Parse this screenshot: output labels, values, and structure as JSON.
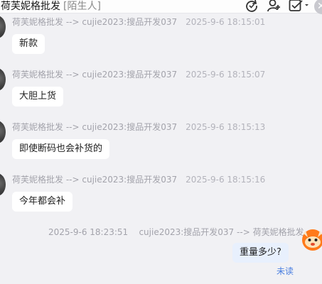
{
  "header": {
    "contact_name": "荷芙妮格批发",
    "stranger_tag": "[陌生人]",
    "icons": [
      "refresh-icon",
      "add-user-icon",
      "check-square-icon",
      "close-icon"
    ]
  },
  "messages": [
    {
      "sender": "荷芙妮格批发",
      "arrow": "-->",
      "receiver": "cujie2023:搜品开发037",
      "time": "2025-9-6 18:15:01",
      "text": "新款"
    },
    {
      "sender": "荷芙妮格批发",
      "arrow": "-->",
      "receiver": "cujie2023:搜品开发037",
      "time": "2025-9-6 18:15:07",
      "text": "大胆上货"
    },
    {
      "sender": "荷芙妮格批发",
      "arrow": "-->",
      "receiver": "cujie2023:搜品开发037",
      "time": "2025-9-6 18:15:13",
      "text": "即使断码也会补货的"
    },
    {
      "sender": "荷芙妮格批发",
      "arrow": "-->",
      "receiver": "cujie2023:搜品开发037",
      "time": "2025-9-6 18:15:16",
      "text": "今年都会补"
    },
    {
      "sender": "cujie2023:搜品开发037",
      "arrow": "-->",
      "receiver": "荷芙妮格批发",
      "time": "2025-9-6 18:23:51",
      "text": "重量多少?",
      "status": "未读"
    }
  ],
  "colors": {
    "background": "#f1f1f4",
    "my_bubble": "#e8f0fd",
    "unread": "#4a7fe0",
    "meta": "#a3a3ab"
  }
}
